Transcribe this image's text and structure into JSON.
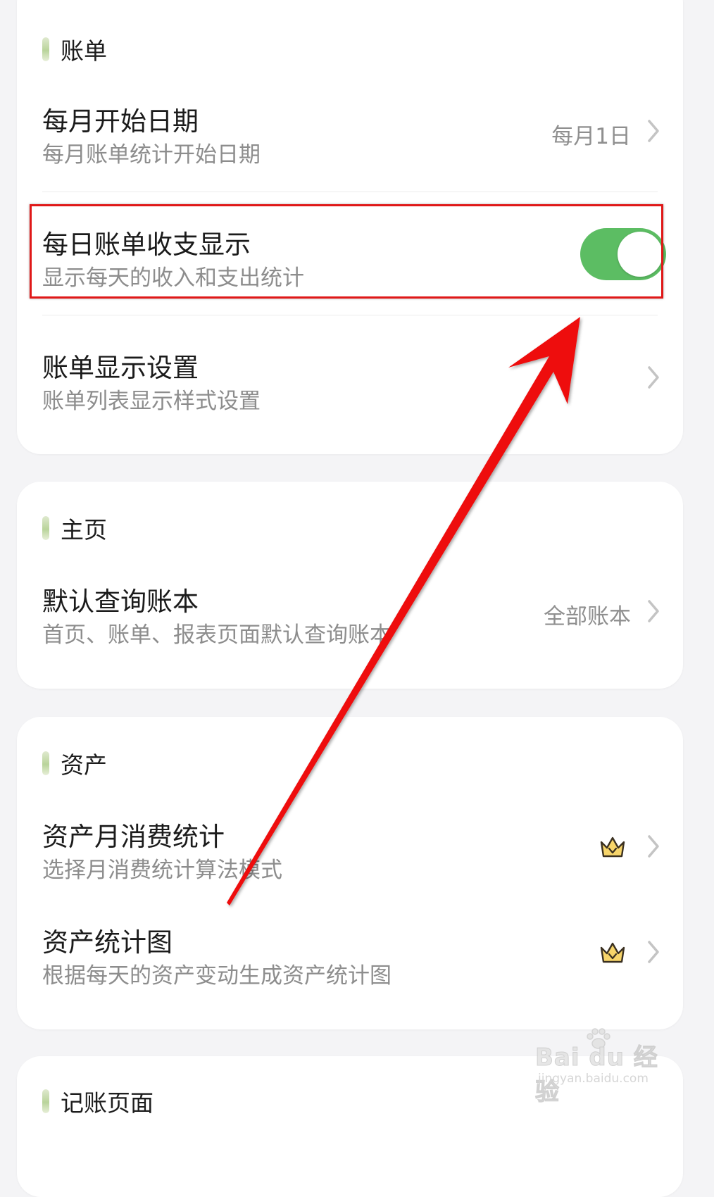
{
  "sections": [
    {
      "title": "账单",
      "rows": [
        {
          "title": "每月开始日期",
          "subtitle": "每月账单统计开始日期",
          "value": "每月1日"
        },
        {
          "title": "每日账单收支显示",
          "subtitle": "显示每天的收入和支出统计",
          "toggle_on": true
        },
        {
          "title": "账单显示设置",
          "subtitle": "账单列表显示样式设置"
        }
      ]
    },
    {
      "title": "主页",
      "rows": [
        {
          "title": "默认查询账本",
          "subtitle": "首页、账单、报表页面默认查询账本",
          "value": "全部账本"
        }
      ]
    },
    {
      "title": "资产",
      "rows": [
        {
          "title": "资产月消费统计",
          "subtitle": "选择月消费统计算法模式",
          "icon": "crown-vip-icon"
        },
        {
          "title": "资产统计图",
          "subtitle": "根据每天的资产变动生成资产统计图",
          "icon": "crown-vip-icon"
        }
      ]
    },
    {
      "title": "记账页面"
    }
  ],
  "watermark": {
    "brand": "Bai du 经验",
    "url": "jingyan.baidu.com"
  },
  "colors": {
    "toggle_on": "#5cbd63",
    "highlight": "#e01818",
    "accent_bar": "#b9d49a"
  }
}
